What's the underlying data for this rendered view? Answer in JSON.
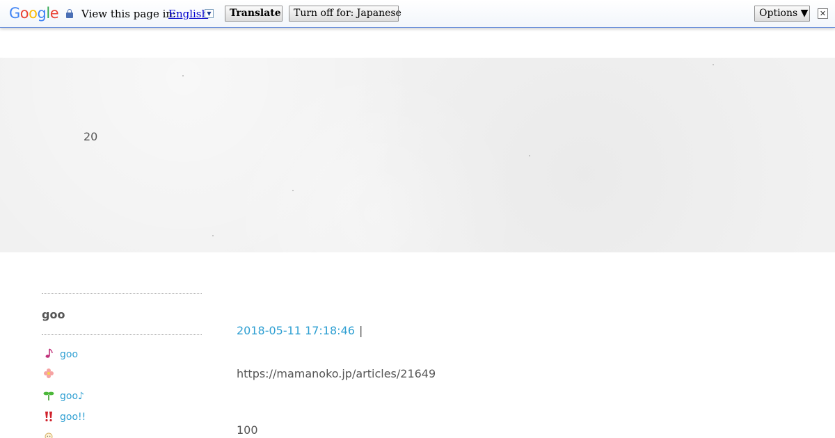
{
  "translate_bar": {
    "logo_letters": [
      {
        "ch": "G",
        "color": "#4285f4"
      },
      {
        "ch": "o",
        "color": "#ea4335"
      },
      {
        "ch": "o",
        "color": "#fbbc05"
      },
      {
        "ch": "g",
        "color": "#4285f4"
      },
      {
        "ch": "l",
        "color": "#34a853"
      },
      {
        "ch": "e",
        "color": "#ea4335"
      }
    ],
    "view_label": "View this page in:",
    "language": "English",
    "dropdown_glyph": "▼",
    "translate_button": "Translate",
    "turn_off_button": "Turn off for: Japanese",
    "options_button": "Options ▼",
    "close_glyph": "✕"
  },
  "banner": {
    "text": "20"
  },
  "sidebar": {
    "title": "goo",
    "items": [
      {
        "icon": "music-note-icon",
        "label": "goo"
      },
      {
        "icon": "flower-icon",
        "label": ""
      },
      {
        "icon": "sprout-icon",
        "label": "goo♪"
      },
      {
        "icon": "double-exclamation-icon",
        "label": "goo!!"
      },
      {
        "icon": "face-icon",
        "label": ""
      }
    ]
  },
  "post": {
    "date": "2018-05-11 17:18:46",
    "separator": "|",
    "url": "https://mamanoko.jp/articles/21649",
    "number": "100"
  },
  "colors": {
    "link": "#2e9fd2",
    "text": "#555555",
    "banner_bg": "#f1f1f1",
    "bar_border": "#6b90da"
  }
}
